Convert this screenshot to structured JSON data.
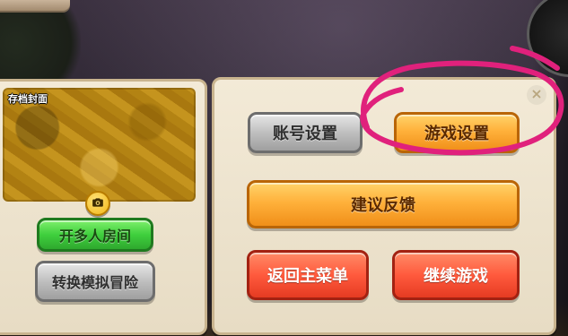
{
  "scene": {
    "top_bar": ""
  },
  "left_panel": {
    "cover_label": "存档封面",
    "buttons": {
      "multiplayer_room": "开多人房间",
      "switch_mode": "转换模拟冒险"
    }
  },
  "right_panel": {
    "buttons": {
      "account_settings": "账号设置",
      "game_settings": "游戏设置",
      "feedback": "建议反馈",
      "back_to_main": "返回主菜单",
      "continue_game": "继续游戏"
    }
  },
  "icons": {
    "camera": "camera-icon",
    "close": "close-icon"
  },
  "colors": {
    "annotation_circle": "#e0217c",
    "orange_button": "#ffb13b",
    "gray_button": "#bfbfbf",
    "green_button": "#3fcf3d",
    "red_button": "#ff5a3d",
    "panel_bg": "#f3ead7"
  }
}
